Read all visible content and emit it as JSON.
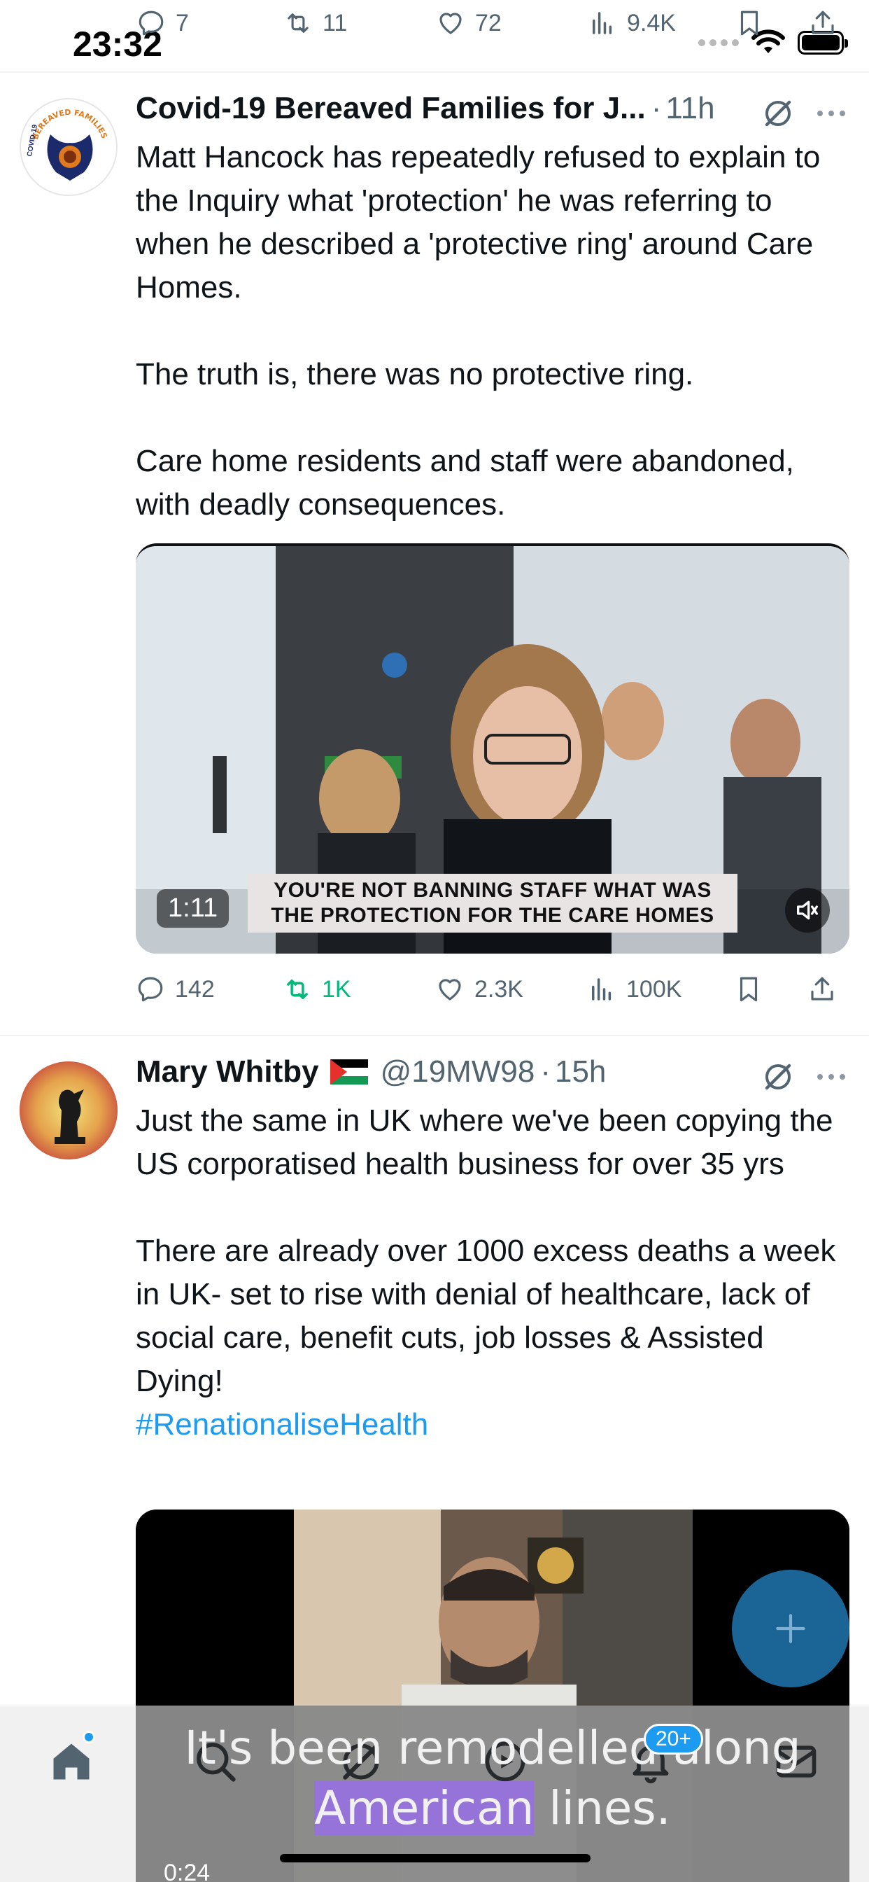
{
  "status_bar": {
    "time": "23:32"
  },
  "previous_tweet_actions": {
    "replies": "7",
    "retweets": "11",
    "likes": "72",
    "views": "9.4K"
  },
  "tweets": [
    {
      "display_name": "Covid-19 Bereaved Families for J...",
      "handle": "",
      "separator": "·",
      "time": "11h",
      "text": "Matt Hancock has repeatedly refused to explain to the Inquiry what 'protection' he was referring to when he described a 'protective ring' around Care Homes.\n\nThe truth is, there was no protective ring.\n\nCare home residents and staff were abandoned, with deadly consequences.",
      "avatar_text": "COVID-19 BEREAVED FAMILIES FOR JUSTICE",
      "media": {
        "caption": "YOU'RE NOT BANNING STAFF WHAT WAS THE PROTECTION FOR THE CARE HOMES",
        "duration": "1:11"
      },
      "actions": {
        "replies": "142",
        "retweets": "1K",
        "likes": "2.3K",
        "views": "100K"
      }
    },
    {
      "display_name": "Mary Whitby",
      "flag": "🇵🇸",
      "handle": "@19MW98",
      "separator": "·",
      "time": "15h",
      "text": "Just the same in UK where we've been copying the US corporatised health business for over 35 yrs\n\nThere are already over 1000 excess deaths a week in UK- set to rise with denial of healthcare, lack of social care, benefit cuts, job losses & Assisted Dying!",
      "hashtag": "#RenationaliseHealth",
      "media": {
        "subtitle_line1": "It's been remodelled along",
        "subtitle_line2_highlight": "American",
        "subtitle_line2_rest": " lines.",
        "duration": "0:24"
      }
    }
  ],
  "bottom_nav": {
    "notifications_badge": "20+"
  },
  "colors": {
    "accent": "#1d9bf0",
    "retweet_green": "#00ba7c",
    "muted": "#536471",
    "fab": "#1a6496"
  }
}
